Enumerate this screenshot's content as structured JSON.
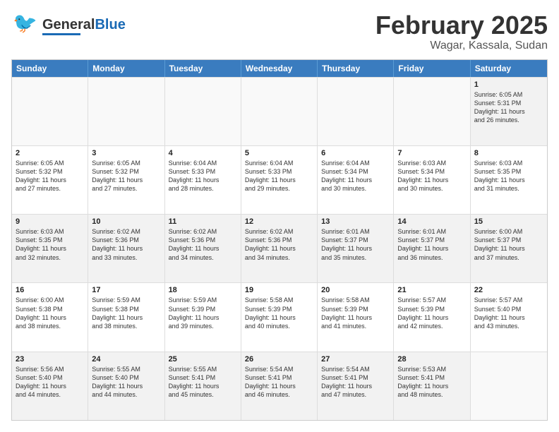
{
  "header": {
    "logo_line1": "General",
    "logo_line2": "Blue",
    "month": "February 2025",
    "location": "Wagar, Kassala, Sudan"
  },
  "weekdays": [
    "Sunday",
    "Monday",
    "Tuesday",
    "Wednesday",
    "Thursday",
    "Friday",
    "Saturday"
  ],
  "rows": [
    [
      {
        "day": "",
        "text": "",
        "empty": true
      },
      {
        "day": "",
        "text": "",
        "empty": true
      },
      {
        "day": "",
        "text": "",
        "empty": true
      },
      {
        "day": "",
        "text": "",
        "empty": true
      },
      {
        "day": "",
        "text": "",
        "empty": true
      },
      {
        "day": "",
        "text": "",
        "empty": true
      },
      {
        "day": "1",
        "text": "Sunrise: 6:05 AM\nSunset: 5:31 PM\nDaylight: 11 hours\nand 26 minutes.",
        "empty": false
      }
    ],
    [
      {
        "day": "2",
        "text": "Sunrise: 6:05 AM\nSunset: 5:32 PM\nDaylight: 11 hours\nand 27 minutes.",
        "empty": false
      },
      {
        "day": "3",
        "text": "Sunrise: 6:05 AM\nSunset: 5:32 PM\nDaylight: 11 hours\nand 27 minutes.",
        "empty": false
      },
      {
        "day": "4",
        "text": "Sunrise: 6:04 AM\nSunset: 5:33 PM\nDaylight: 11 hours\nand 28 minutes.",
        "empty": false
      },
      {
        "day": "5",
        "text": "Sunrise: 6:04 AM\nSunset: 5:33 PM\nDaylight: 11 hours\nand 29 minutes.",
        "empty": false
      },
      {
        "day": "6",
        "text": "Sunrise: 6:04 AM\nSunset: 5:34 PM\nDaylight: 11 hours\nand 30 minutes.",
        "empty": false
      },
      {
        "day": "7",
        "text": "Sunrise: 6:03 AM\nSunset: 5:34 PM\nDaylight: 11 hours\nand 30 minutes.",
        "empty": false
      },
      {
        "day": "8",
        "text": "Sunrise: 6:03 AM\nSunset: 5:35 PM\nDaylight: 11 hours\nand 31 minutes.",
        "empty": false
      }
    ],
    [
      {
        "day": "9",
        "text": "Sunrise: 6:03 AM\nSunset: 5:35 PM\nDaylight: 11 hours\nand 32 minutes.",
        "empty": false
      },
      {
        "day": "10",
        "text": "Sunrise: 6:02 AM\nSunset: 5:36 PM\nDaylight: 11 hours\nand 33 minutes.",
        "empty": false
      },
      {
        "day": "11",
        "text": "Sunrise: 6:02 AM\nSunset: 5:36 PM\nDaylight: 11 hours\nand 34 minutes.",
        "empty": false
      },
      {
        "day": "12",
        "text": "Sunrise: 6:02 AM\nSunset: 5:36 PM\nDaylight: 11 hours\nand 34 minutes.",
        "empty": false
      },
      {
        "day": "13",
        "text": "Sunrise: 6:01 AM\nSunset: 5:37 PM\nDaylight: 11 hours\nand 35 minutes.",
        "empty": false
      },
      {
        "day": "14",
        "text": "Sunrise: 6:01 AM\nSunset: 5:37 PM\nDaylight: 11 hours\nand 36 minutes.",
        "empty": false
      },
      {
        "day": "15",
        "text": "Sunrise: 6:00 AM\nSunset: 5:37 PM\nDaylight: 11 hours\nand 37 minutes.",
        "empty": false
      }
    ],
    [
      {
        "day": "16",
        "text": "Sunrise: 6:00 AM\nSunset: 5:38 PM\nDaylight: 11 hours\nand 38 minutes.",
        "empty": false
      },
      {
        "day": "17",
        "text": "Sunrise: 5:59 AM\nSunset: 5:38 PM\nDaylight: 11 hours\nand 38 minutes.",
        "empty": false
      },
      {
        "day": "18",
        "text": "Sunrise: 5:59 AM\nSunset: 5:39 PM\nDaylight: 11 hours\nand 39 minutes.",
        "empty": false
      },
      {
        "day": "19",
        "text": "Sunrise: 5:58 AM\nSunset: 5:39 PM\nDaylight: 11 hours\nand 40 minutes.",
        "empty": false
      },
      {
        "day": "20",
        "text": "Sunrise: 5:58 AM\nSunset: 5:39 PM\nDaylight: 11 hours\nand 41 minutes.",
        "empty": false
      },
      {
        "day": "21",
        "text": "Sunrise: 5:57 AM\nSunset: 5:39 PM\nDaylight: 11 hours\nand 42 minutes.",
        "empty": false
      },
      {
        "day": "22",
        "text": "Sunrise: 5:57 AM\nSunset: 5:40 PM\nDaylight: 11 hours\nand 43 minutes.",
        "empty": false
      }
    ],
    [
      {
        "day": "23",
        "text": "Sunrise: 5:56 AM\nSunset: 5:40 PM\nDaylight: 11 hours\nand 44 minutes.",
        "empty": false
      },
      {
        "day": "24",
        "text": "Sunrise: 5:55 AM\nSunset: 5:40 PM\nDaylight: 11 hours\nand 44 minutes.",
        "empty": false
      },
      {
        "day": "25",
        "text": "Sunrise: 5:55 AM\nSunset: 5:41 PM\nDaylight: 11 hours\nand 45 minutes.",
        "empty": false
      },
      {
        "day": "26",
        "text": "Sunrise: 5:54 AM\nSunset: 5:41 PM\nDaylight: 11 hours\nand 46 minutes.",
        "empty": false
      },
      {
        "day": "27",
        "text": "Sunrise: 5:54 AM\nSunset: 5:41 PM\nDaylight: 11 hours\nand 47 minutes.",
        "empty": false
      },
      {
        "day": "28",
        "text": "Sunrise: 5:53 AM\nSunset: 5:41 PM\nDaylight: 11 hours\nand 48 minutes.",
        "empty": false
      },
      {
        "day": "",
        "text": "",
        "empty": true
      }
    ]
  ]
}
